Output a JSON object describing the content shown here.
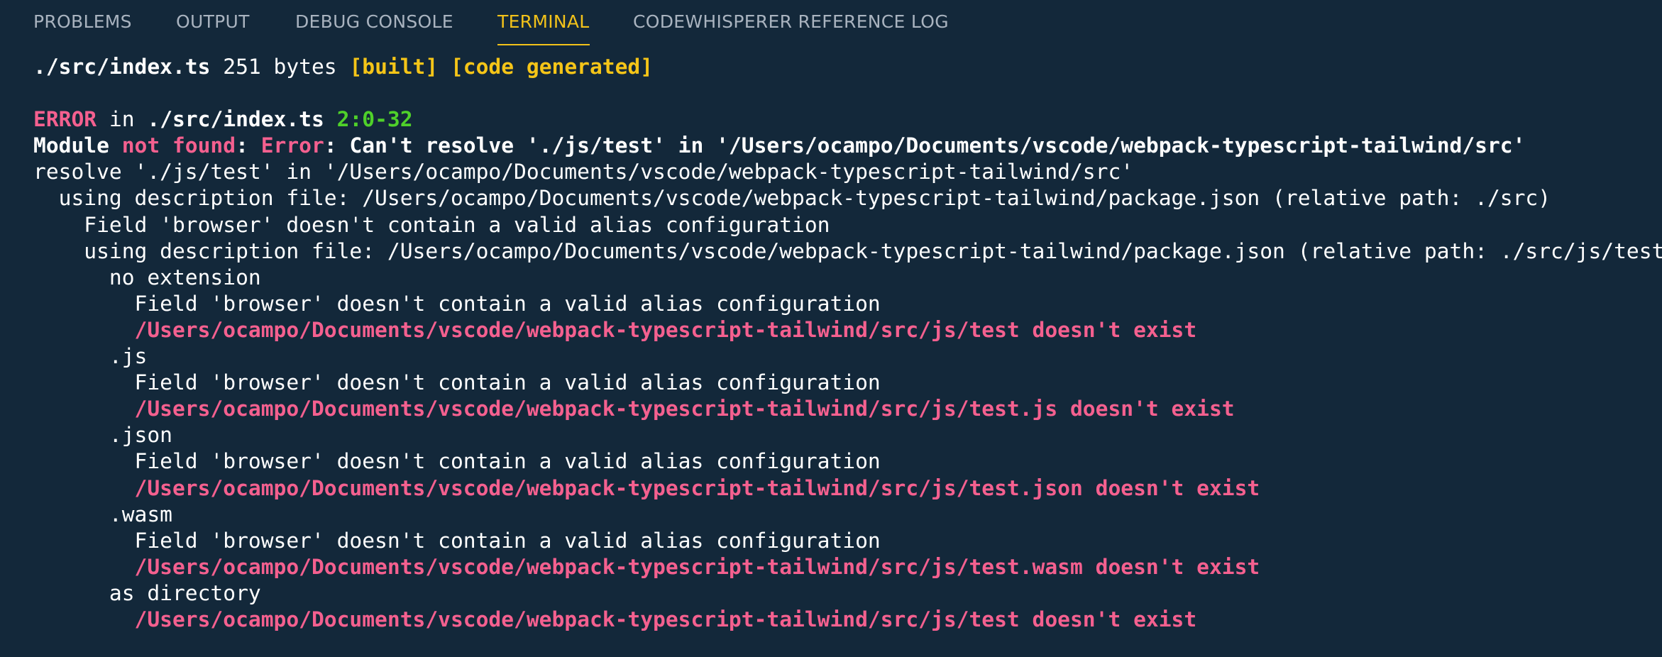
{
  "tabs": [
    {
      "label": "PROBLEMS",
      "active": false
    },
    {
      "label": "OUTPUT",
      "active": false
    },
    {
      "label": "DEBUG CONSOLE",
      "active": false
    },
    {
      "label": "TERMINAL",
      "active": true
    },
    {
      "label": "CODEWHISPERER REFERENCE LOG",
      "active": false
    }
  ],
  "colors": {
    "background": "#13283a",
    "tab_inactive": "#a9b3bf",
    "tab_active": "#f2c21a",
    "text": "#ffffff",
    "highlight_yellow": "#f5c518",
    "error_pink": "#f4608f",
    "location_green": "#4fd12a"
  },
  "terminal": {
    "build_line": {
      "file": "./src/index.ts",
      "size": " 251 bytes ",
      "tag_built": "[built]",
      "space": " ",
      "tag_generated": "[code generated]"
    },
    "error_header": {
      "label": "ERROR",
      "in_text": " in ",
      "file": "./src/index.ts",
      "space": " ",
      "location": "2:0-32"
    },
    "module_line": {
      "prefix": "Module ",
      "not_found": "not found",
      "colon1": ": ",
      "error": "Error",
      "message": ": Can't resolve './js/test' in '/Users/ocampo/Documents/vscode/webpack-typescript-tailwind/src'"
    },
    "lines": [
      {
        "text": "resolve './js/test' in '/Users/ocampo/Documents/vscode/webpack-typescript-tailwind/src'",
        "style": "plain"
      },
      {
        "text": "  using description file: /Users/ocampo/Documents/vscode/webpack-typescript-tailwind/package.json (relative path: ./src)",
        "style": "plain"
      },
      {
        "text": "    Field 'browser' doesn't contain a valid alias configuration",
        "style": "plain"
      },
      {
        "text": "    using description file: /Users/ocampo/Documents/vscode/webpack-typescript-tailwind/package.json (relative path: ./src/js/test)",
        "style": "plain"
      },
      {
        "text": "      no extension",
        "style": "plain"
      },
      {
        "text": "        Field 'browser' doesn't contain a valid alias configuration",
        "style": "plain"
      },
      {
        "text": "        /Users/ocampo/Documents/vscode/webpack-typescript-tailwind/src/js/test doesn't exist",
        "style": "error"
      },
      {
        "text": "      .js",
        "style": "plain"
      },
      {
        "text": "        Field 'browser' doesn't contain a valid alias configuration",
        "style": "plain"
      },
      {
        "text": "        /Users/ocampo/Documents/vscode/webpack-typescript-tailwind/src/js/test.js doesn't exist",
        "style": "error"
      },
      {
        "text": "      .json",
        "style": "plain"
      },
      {
        "text": "        Field 'browser' doesn't contain a valid alias configuration",
        "style": "plain"
      },
      {
        "text": "        /Users/ocampo/Documents/vscode/webpack-typescript-tailwind/src/js/test.json doesn't exist",
        "style": "error"
      },
      {
        "text": "      .wasm",
        "style": "plain"
      },
      {
        "text": "        Field 'browser' doesn't contain a valid alias configuration",
        "style": "plain"
      },
      {
        "text": "        /Users/ocampo/Documents/vscode/webpack-typescript-tailwind/src/js/test.wasm doesn't exist",
        "style": "error"
      },
      {
        "text": "      as directory",
        "style": "plain"
      },
      {
        "text": "        /Users/ocampo/Documents/vscode/webpack-typescript-tailwind/src/js/test doesn't exist",
        "style": "error"
      }
    ]
  }
}
